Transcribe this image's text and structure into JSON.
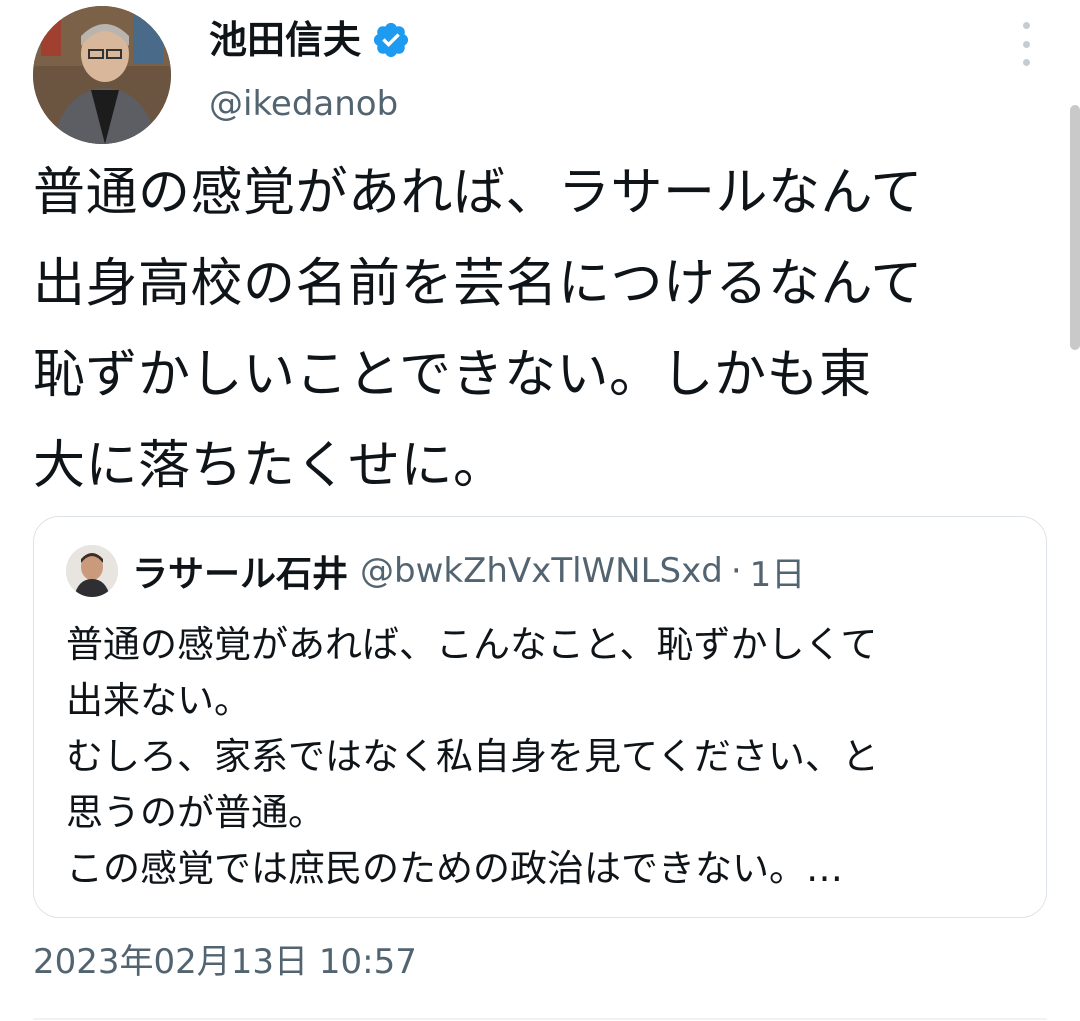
{
  "author": {
    "name": "池田信夫",
    "handle": "@ikedanob",
    "verified": true
  },
  "tweet": {
    "text": "普通の感覚があれば、ラサールなんて\n出身高校の名前を芸名につけるなんて\n恥ずかしいことできない。しかも東\n大に落ちたくせに。"
  },
  "quote": {
    "name": "ラサール石井",
    "handle": "@bwkZhVxTlWNLSxd",
    "separator": "·",
    "time": "1日",
    "text": "普通の感覚があれば、こんなこと、恥ずかしくて\n出来ない。\nむしろ、家系ではなく私自身を見てください、と\n思うのが普通。\nこの感覚では庶民のための政治はできない。…"
  },
  "timestamp": "2023年02月13日 10:57",
  "colors": {
    "verified": "#1d9bf0",
    "secondary_text": "#536471",
    "border": "#dde3e8"
  },
  "icons": [
    "verified-badge-icon",
    "more-options-icon"
  ]
}
